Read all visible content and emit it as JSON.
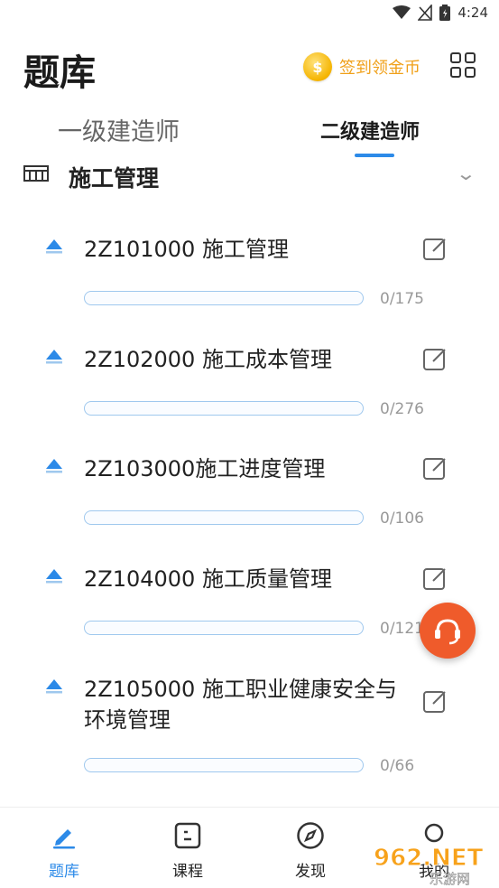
{
  "status_bar": {
    "time": "4:24"
  },
  "header": {
    "title": "题库",
    "checkin_label": "签到领金币",
    "coin_glyph": "$"
  },
  "tabs": [
    {
      "label": "一级建造师",
      "active": false
    },
    {
      "label": "二级建造师",
      "active": true
    }
  ],
  "section": {
    "title": "施工管理"
  },
  "chapters": [
    {
      "title": "2Z101000 施工管理",
      "done": 0,
      "total": 175,
      "count_label": "0/175"
    },
    {
      "title": "2Z102000 施工成本管理",
      "done": 0,
      "total": 276,
      "count_label": "0/276"
    },
    {
      "title": "2Z103000施工进度管理",
      "done": 0,
      "total": 106,
      "count_label": "0/106"
    },
    {
      "title": "2Z104000 施工质量管理",
      "done": 0,
      "total": 121,
      "count_label": "0/121"
    },
    {
      "title": "2Z105000 施工职业健康安全与环境管理",
      "done": 0,
      "total": 66,
      "count_label": "0/66"
    }
  ],
  "bottom_nav": [
    {
      "label": "题库",
      "icon": "pencil-icon",
      "active": true
    },
    {
      "label": "课程",
      "icon": "course-icon",
      "active": false
    },
    {
      "label": "发现",
      "icon": "compass-icon",
      "active": false
    },
    {
      "label": "我的",
      "icon": "user-icon",
      "active": false
    }
  ],
  "watermark": {
    "text": "962.NET",
    "subtext": "乐游网"
  },
  "colors": {
    "accent": "#2c8ae8",
    "coin": "#f5b400",
    "checkin_text": "#f0a019",
    "fab": "#ef5b2b"
  }
}
